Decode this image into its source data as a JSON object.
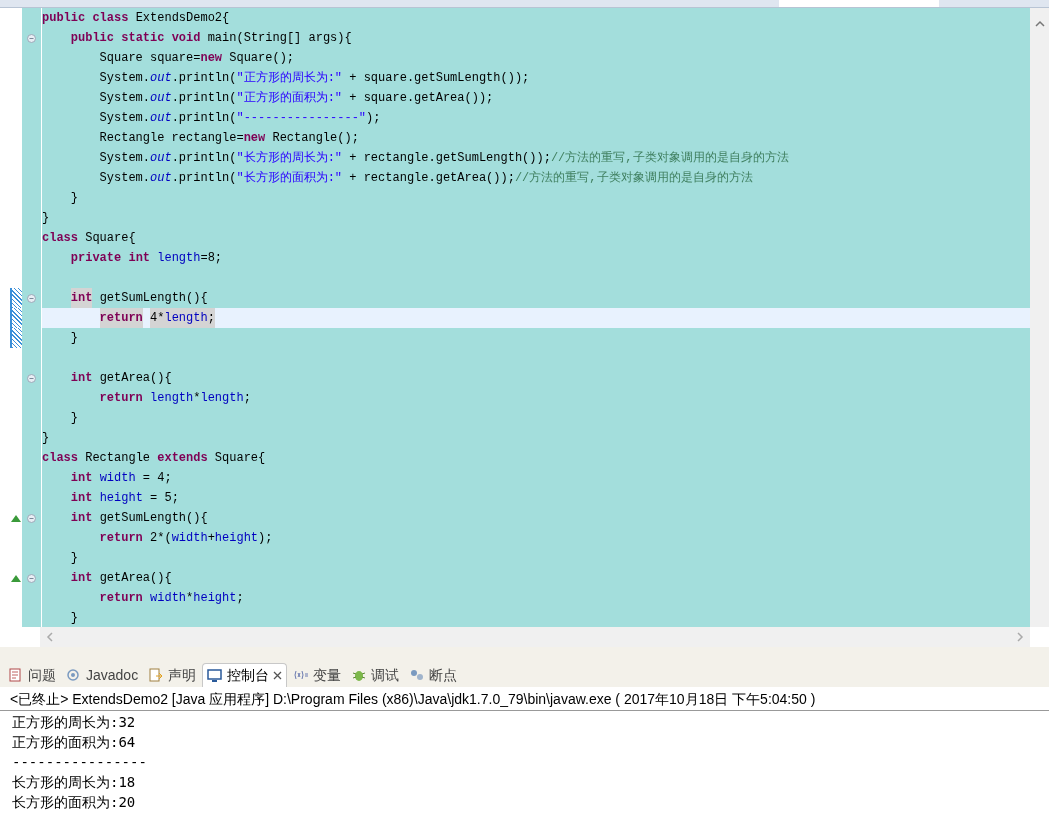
{
  "editor": {
    "lines": [
      {
        "kind": "code",
        "tokens": [
          {
            "kind": "keyword",
            "text": "public"
          },
          {
            "kind": "keyword",
            "text": " class"
          },
          {
            "kind": "plain",
            "text": " ExtendsDemo2{"
          }
        ]
      },
      {
        "kind": "code",
        "fold": true,
        "tokens": [
          {
            "kind": "keyword",
            "text": "    public"
          },
          {
            "kind": "keyword",
            "text": " static"
          },
          {
            "kind": "keyword",
            "text": " void"
          },
          {
            "kind": "plain",
            "text": " main(String[] args){"
          }
        ]
      },
      {
        "kind": "code",
        "tokens": [
          {
            "kind": "plain",
            "text": "        Square square="
          },
          {
            "kind": "keyword",
            "text": "new"
          },
          {
            "kind": "plain",
            "text": " Square();"
          }
        ]
      },
      {
        "kind": "code",
        "tokens": [
          {
            "kind": "plain",
            "text": "        System."
          },
          {
            "kind": "static",
            "text": "out"
          },
          {
            "kind": "plain",
            "text": ".println("
          },
          {
            "kind": "string",
            "text": "\"正方形的周长为:\""
          },
          {
            "kind": "plain",
            "text": " + square.getSumLength());"
          }
        ]
      },
      {
        "kind": "code",
        "tokens": [
          {
            "kind": "plain",
            "text": "        System."
          },
          {
            "kind": "static",
            "text": "out"
          },
          {
            "kind": "plain",
            "text": ".println("
          },
          {
            "kind": "string",
            "text": "\"正方形的面积为:\""
          },
          {
            "kind": "plain",
            "text": " + square.getArea());"
          }
        ]
      },
      {
        "kind": "code",
        "tokens": [
          {
            "kind": "plain",
            "text": "        System."
          },
          {
            "kind": "static",
            "text": "out"
          },
          {
            "kind": "plain",
            "text": ".println("
          },
          {
            "kind": "string",
            "text": "\"----------------\""
          },
          {
            "kind": "plain",
            "text": ");"
          }
        ]
      },
      {
        "kind": "code",
        "tokens": [
          {
            "kind": "plain",
            "text": "        Rectangle rectangle="
          },
          {
            "kind": "keyword",
            "text": "new"
          },
          {
            "kind": "plain",
            "text": " Rectangle();"
          }
        ]
      },
      {
        "kind": "code",
        "tokens": [
          {
            "kind": "plain",
            "text": "        System."
          },
          {
            "kind": "static",
            "text": "out"
          },
          {
            "kind": "plain",
            "text": ".println("
          },
          {
            "kind": "string",
            "text": "\"长方形的周长为:\""
          },
          {
            "kind": "plain",
            "text": " + rectangle.getSumLength());"
          },
          {
            "kind": "comment",
            "text": "//方法的重写,子类对象调用的是自身的方法"
          }
        ]
      },
      {
        "kind": "code",
        "tokens": [
          {
            "kind": "plain",
            "text": "        System."
          },
          {
            "kind": "static",
            "text": "out"
          },
          {
            "kind": "plain",
            "text": ".println("
          },
          {
            "kind": "string",
            "text": "\"长方形的面积为:\""
          },
          {
            "kind": "plain",
            "text": " + rectangle.getArea());"
          },
          {
            "kind": "comment",
            "text": "//方法的重写,子类对象调用的是自身的方法"
          }
        ]
      },
      {
        "kind": "code",
        "tokens": [
          {
            "kind": "plain",
            "text": "    }"
          }
        ]
      },
      {
        "kind": "code",
        "tokens": [
          {
            "kind": "plain",
            "text": "}"
          }
        ]
      },
      {
        "kind": "code",
        "tokens": [
          {
            "kind": "keyword",
            "text": "class"
          },
          {
            "kind": "plain",
            "text": " Square{"
          }
        ]
      },
      {
        "kind": "code",
        "tokens": [
          {
            "kind": "keyword",
            "text": "    private"
          },
          {
            "kind": "keyword",
            "text": " int"
          },
          {
            "kind": "field",
            "text": " length"
          },
          {
            "kind": "plain",
            "text": "=8;"
          }
        ]
      },
      {
        "kind": "blank"
      },
      {
        "kind": "code",
        "fold": true,
        "change_marker": true,
        "tokens": [
          {
            "kind": "keyword",
            "text": "    int",
            "marked": true
          },
          {
            "kind": "plain",
            "text": " getSumLength(){"
          }
        ]
      },
      {
        "kind": "code",
        "current": true,
        "change_marker": true,
        "tokens": [
          {
            "kind": "keyword",
            "text": "        return",
            "marked": true
          },
          {
            "kind": "plain",
            "text": " 4*",
            "marked": true
          },
          {
            "kind": "field",
            "text": "length",
            "marked": true
          },
          {
            "kind": "plain",
            "text": ";",
            "marked": true
          }
        ]
      },
      {
        "kind": "code",
        "change_marker": true,
        "tokens": [
          {
            "kind": "plain",
            "text": "    }"
          }
        ]
      },
      {
        "kind": "blank"
      },
      {
        "kind": "code",
        "fold": true,
        "tokens": [
          {
            "kind": "keyword",
            "text": "    int"
          },
          {
            "kind": "plain",
            "text": " getArea(){"
          }
        ]
      },
      {
        "kind": "code",
        "tokens": [
          {
            "kind": "keyword",
            "text": "        return"
          },
          {
            "kind": "field",
            "text": " length"
          },
          {
            "kind": "plain",
            "text": "*"
          },
          {
            "kind": "field",
            "text": "length"
          },
          {
            "kind": "plain",
            "text": ";"
          }
        ]
      },
      {
        "kind": "code",
        "tokens": [
          {
            "kind": "plain",
            "text": "    }"
          }
        ]
      },
      {
        "kind": "code",
        "tokens": [
          {
            "kind": "plain",
            "text": "}"
          }
        ]
      },
      {
        "kind": "code",
        "tokens": [
          {
            "kind": "keyword",
            "text": "class"
          },
          {
            "kind": "plain",
            "text": " Rectangle"
          },
          {
            "kind": "keyword",
            "text": " extends"
          },
          {
            "kind": "plain",
            "text": " Square{"
          }
        ]
      },
      {
        "kind": "code",
        "tokens": [
          {
            "kind": "keyword",
            "text": "    int"
          },
          {
            "kind": "field",
            "text": " width"
          },
          {
            "kind": "plain",
            "text": " = 4;"
          }
        ]
      },
      {
        "kind": "code",
        "tokens": [
          {
            "kind": "keyword",
            "text": "    int"
          },
          {
            "kind": "field",
            "text": " height"
          },
          {
            "kind": "plain",
            "text": " = 5;"
          }
        ]
      },
      {
        "kind": "code",
        "fold": true,
        "override": true,
        "tokens": [
          {
            "kind": "keyword",
            "text": "    int"
          },
          {
            "kind": "plain",
            "text": " getSumLength(){"
          }
        ]
      },
      {
        "kind": "code",
        "tokens": [
          {
            "kind": "keyword",
            "text": "        return"
          },
          {
            "kind": "plain",
            "text": " 2*("
          },
          {
            "kind": "field",
            "text": "width"
          },
          {
            "kind": "plain",
            "text": "+"
          },
          {
            "kind": "field",
            "text": "height"
          },
          {
            "kind": "plain",
            "text": ");"
          }
        ]
      },
      {
        "kind": "code",
        "tokens": [
          {
            "kind": "plain",
            "text": "    }"
          }
        ]
      },
      {
        "kind": "code",
        "fold": true,
        "override": true,
        "tokens": [
          {
            "kind": "keyword",
            "text": "    int"
          },
          {
            "kind": "plain",
            "text": " getArea(){"
          }
        ]
      },
      {
        "kind": "code",
        "tokens": [
          {
            "kind": "keyword",
            "text": "        return"
          },
          {
            "kind": "field",
            "text": " width"
          },
          {
            "kind": "plain",
            "text": "*"
          },
          {
            "kind": "field",
            "text": "height"
          },
          {
            "kind": "plain",
            "text": ";"
          }
        ]
      },
      {
        "kind": "code",
        "tokens": [
          {
            "kind": "plain",
            "text": "    }"
          }
        ]
      }
    ]
  },
  "panel_tabs": [
    {
      "kind": "problems",
      "label": "问题",
      "selected": false
    },
    {
      "kind": "javadoc",
      "label": "Javadoc",
      "selected": false
    },
    {
      "kind": "declaration",
      "label": "声明",
      "selected": false
    },
    {
      "kind": "console",
      "label": "控制台",
      "selected": true
    },
    {
      "kind": "variables",
      "label": "变量",
      "selected": false
    },
    {
      "kind": "debug",
      "label": "调试",
      "selected": false
    },
    {
      "kind": "breakpoints",
      "label": "断点",
      "selected": false
    }
  ],
  "console": {
    "header": "<已终止> ExtendsDemo2 [Java 应用程序] D:\\Program Files (x86)\\Java\\jdk1.7.0_79\\bin\\javaw.exe ( 2017年10月18日 下午5:04:50 )",
    "output": [
      "正方形的周长为:32",
      "正方形的面积为:64",
      "----------------",
      "长方形的周长为:18",
      "长方形的面积为:20"
    ]
  }
}
